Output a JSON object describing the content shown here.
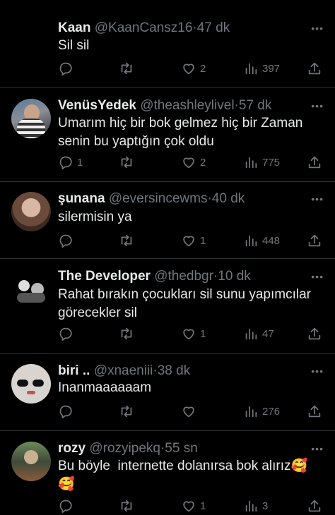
{
  "tweets": [
    {
      "name": "Kaan",
      "handle": "@KaanCansz16",
      "sep": "·",
      "time": "47 dk",
      "text": "Sil sil",
      "replies": "",
      "likes": "2",
      "views": "397"
    },
    {
      "name": "VenüsYedek",
      "handle": "@theashleylivel",
      "sep": "·",
      "time": "57 dk",
      "text": "Umarım hiç bir bok gelmez hiç bir Zaman senin bu yaptığın çok oldu",
      "replies": "1",
      "likes": "2",
      "views": "775"
    },
    {
      "name": "şunana",
      "handle": "@eversincewms",
      "sep": "·",
      "time": "40 dk",
      "text": "silermisin ya",
      "replies": "",
      "likes": "1",
      "views": "448"
    },
    {
      "name": "The Developer",
      "handle": "@thedbgr",
      "sep": "·",
      "time": "10 dk",
      "text": "Rahat bırakın çocukları sil sunu yapımcılar görecekler sil",
      "replies": "",
      "likes": "1",
      "views": "47"
    },
    {
      "name": "biri ..",
      "handle": "@xnaeniii",
      "sep": "·",
      "time": "38 dk",
      "text": "Inanmaaaaaam",
      "replies": "",
      "likes": "",
      "views": "276"
    },
    {
      "name": "rozy",
      "handle": "@rozyipekq",
      "sep": "·",
      "time": "55 sn",
      "text": "Bu böyle  internette dolanırsa bok alırız🥰\n🥰",
      "replies": "",
      "likes": "1",
      "views": "3"
    }
  ],
  "more_label": "•••",
  "icons": {
    "reply": "reply-icon",
    "retweet": "retweet-icon",
    "like": "heart-icon",
    "views": "views-icon",
    "share": "share-icon"
  }
}
